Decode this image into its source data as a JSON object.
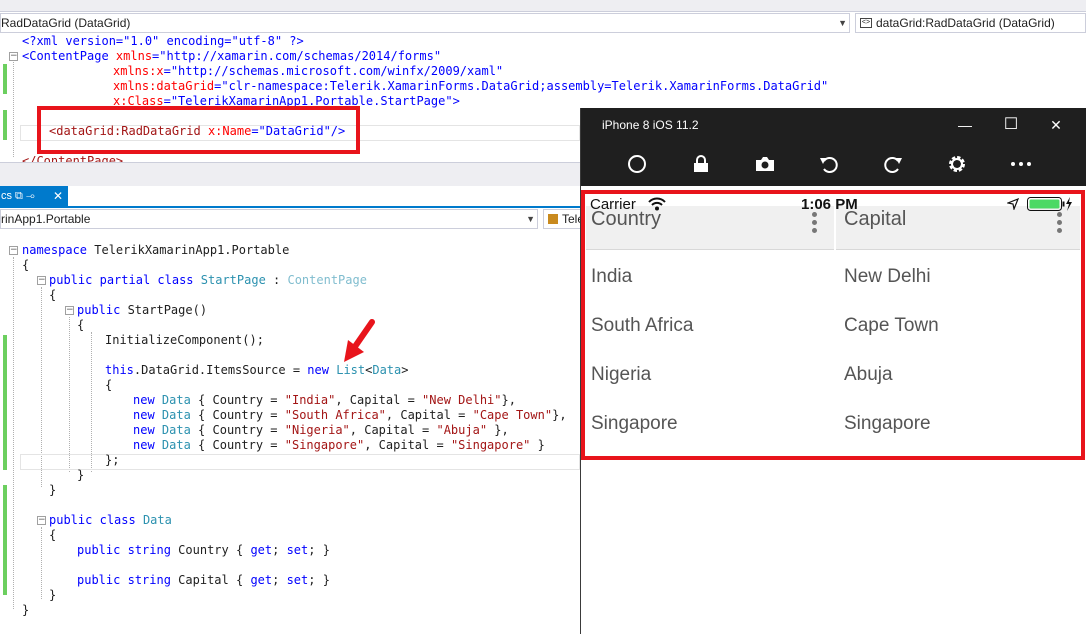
{
  "xaml_nav": {
    "left": "RadDataGrid (DataGrid)",
    "right": "dataGrid:RadDataGrid (DataGrid)"
  },
  "xaml": {
    "l1": "<?xml version=\"1.0\" encoding=\"utf-8\" ?>",
    "l2_tag": "<ContentPage ",
    "l2_attr": "xmlns",
    "l2_val": "\"http://xamarin.com/schemas/2014/forms\"",
    "l3_attr": "xmlns:x",
    "l3_val": "\"http://schemas.microsoft.com/winfx/2009/xaml\"",
    "l4_attr": "xmlns:dataGrid",
    "l4_val": "\"clr-namespace:Telerik.XamarinForms.DataGrid;assembly=Telerik.XamarinForms.DataGrid\"",
    "l5_attr": "x:Class",
    "l5_val": "\"TelerikXamarinApp1.Portable.StartPage\"",
    "l5_end": ">",
    "l7_tag": "<dataGrid:RadDataGrid ",
    "l7_attr": "x:Name",
    "l7_val": "\"DataGrid\"",
    "l7_end": "/>",
    "l8": "</ContentPage>",
    "eq": "="
  },
  "cs_tab": {
    "label": "cs ⧉ ⊸",
    "close": "✕"
  },
  "cs_nav": {
    "left": "rinApp1.Portable",
    "right": "Tele"
  },
  "cs": {
    "namespace_kw": "namespace",
    "namespace_name": " TelerikXamarinApp1.Portable",
    "open": "{",
    "close": "}",
    "public_kw": "public",
    "partial_kw": "partial",
    "class_kw": "class",
    "startpage_type": "StartPage",
    "colon": " : ",
    "contentpage_type": "ContentPage",
    "ctor": " StartPage()",
    "init": "InitializeComponent();",
    "this_kw": "this",
    "items_source": ".DataGrid.ItemsSource = ",
    "new_kw": "new",
    "list_type": "List",
    "lt": "<",
    "data_type": "Data",
    "gt": ">",
    "country_prop": " { Country = ",
    "capital_prop": ", Capital = ",
    "r1_country": "\"India\"",
    "r1_capital": "\"New Delhi\"",
    "r1_end": "},",
    "r2_country": "\"South Africa\"",
    "r2_capital": "\"Cape Town\"",
    "r2_end": "},",
    "r3_country": "\"Nigeria\"",
    "r3_capital": "\"Abuja\"",
    "r3_end": " },",
    "r4_country": "\"Singapore\"",
    "r4_capital": "\"Singapore\"",
    "r4_end": " }",
    "list_end": "};",
    "string_kw": "string",
    "country_decl": " Country { ",
    "capital_decl": " Capital { ",
    "get_kw": "get",
    "set_kw": "set",
    "sep": "; ",
    "decl_end": "; }"
  },
  "simulator": {
    "title": "iPhone 8 iOS 11.2",
    "minimize": "—",
    "maximize": "☐",
    "close": "✕"
  },
  "phone": {
    "carrier": "Carrier",
    "time": "1:06 PM",
    "headers": [
      "Country",
      "Capital"
    ],
    "rows": [
      {
        "country": "India",
        "capital": "New Delhi"
      },
      {
        "country": "South Africa",
        "capital": "Cape Town"
      },
      {
        "country": "Nigeria",
        "capital": "Abuja"
      },
      {
        "country": "Singapore",
        "capital": "Singapore"
      }
    ]
  },
  "colors": {
    "highlight_border": "#e8141b",
    "ide_accent": "#007acc",
    "change_bar": "#6ccf5f",
    "battery": "#4cd964"
  }
}
